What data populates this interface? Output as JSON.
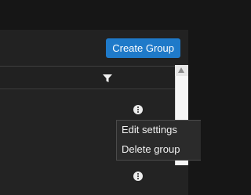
{
  "toolbar": {
    "create_group_label": "Create Group"
  },
  "table": {
    "filter_icon": "filter-icon"
  },
  "rows": [
    {
      "actions_icon": "more-actions-icon"
    },
    {
      "actions_icon": "more-actions-icon"
    }
  ],
  "context_menu": {
    "items": [
      {
        "label": "Edit settings"
      },
      {
        "label": "Delete group"
      }
    ]
  },
  "colors": {
    "accent": "#1f7ac9",
    "background": "#232323",
    "menu_background": "#2b2b2b",
    "text": "#f2f2f2"
  }
}
